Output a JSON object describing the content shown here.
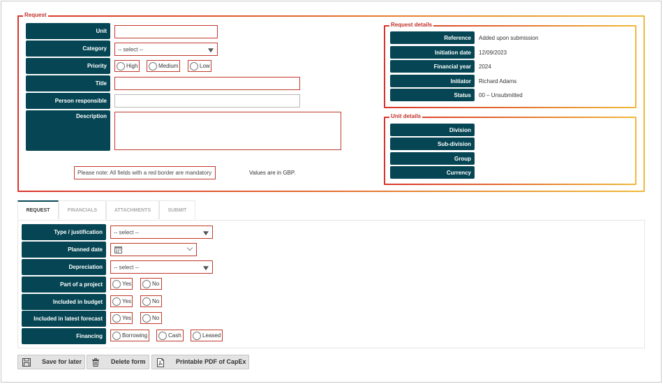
{
  "request": {
    "legend": "Request",
    "fields": {
      "unit_label": "Unit",
      "category_label": "Category",
      "category_value": "-- select --",
      "priority_label": "Priority",
      "priority_options": [
        "High",
        "Medium",
        "Low"
      ],
      "title_label": "Title",
      "person_label": "Person responsible",
      "description_label": "Description"
    },
    "note": "Please note: All fields with a red border are mandatory",
    "currency_note": "Values are in GBP."
  },
  "request_details": {
    "legend": "Request details",
    "rows": [
      {
        "label": "Reference",
        "value": "Added upon submission"
      },
      {
        "label": "Initiation date",
        "value": "12/09/2023"
      },
      {
        "label": "Financial year",
        "value": "2024"
      },
      {
        "label": "Initiator",
        "value": "Richard Adams"
      },
      {
        "label": "Status",
        "value": "00 – Unsubmitted"
      }
    ]
  },
  "unit_details": {
    "legend": "Unit details",
    "rows": [
      {
        "label": "Division",
        "value": ""
      },
      {
        "label": "Sub-division",
        "value": ""
      },
      {
        "label": "Group",
        "value": ""
      },
      {
        "label": "Currency",
        "value": ""
      }
    ]
  },
  "tabs": [
    "REQUEST",
    "FINANCIALS",
    "ATTACHMENTS",
    "SUBMIT"
  ],
  "request_tab": {
    "type_label": "Type / justification",
    "type_value": "-- select --",
    "planned_date_label": "Planned date",
    "depreciation_label": "Depreciation",
    "depreciation_value": "-- select --",
    "part_of_project_label": "Part of a project",
    "included_budget_label": "Included in budget",
    "included_forecast_label": "Included in latest forecast",
    "financing_label": "Financing",
    "yes": "Yes",
    "no": "No",
    "financing_options": [
      "Borrowing",
      "Cash",
      "Leased"
    ]
  },
  "buttons": {
    "save": "Save for later",
    "delete": "Delete form",
    "pdf": "Printable PDF of CapEx"
  },
  "colors": {
    "label_bg": "#064654",
    "mandatory_border": "#c0392b",
    "gradient_start": "#d9342b",
    "gradient_end": "#f0b93a"
  }
}
